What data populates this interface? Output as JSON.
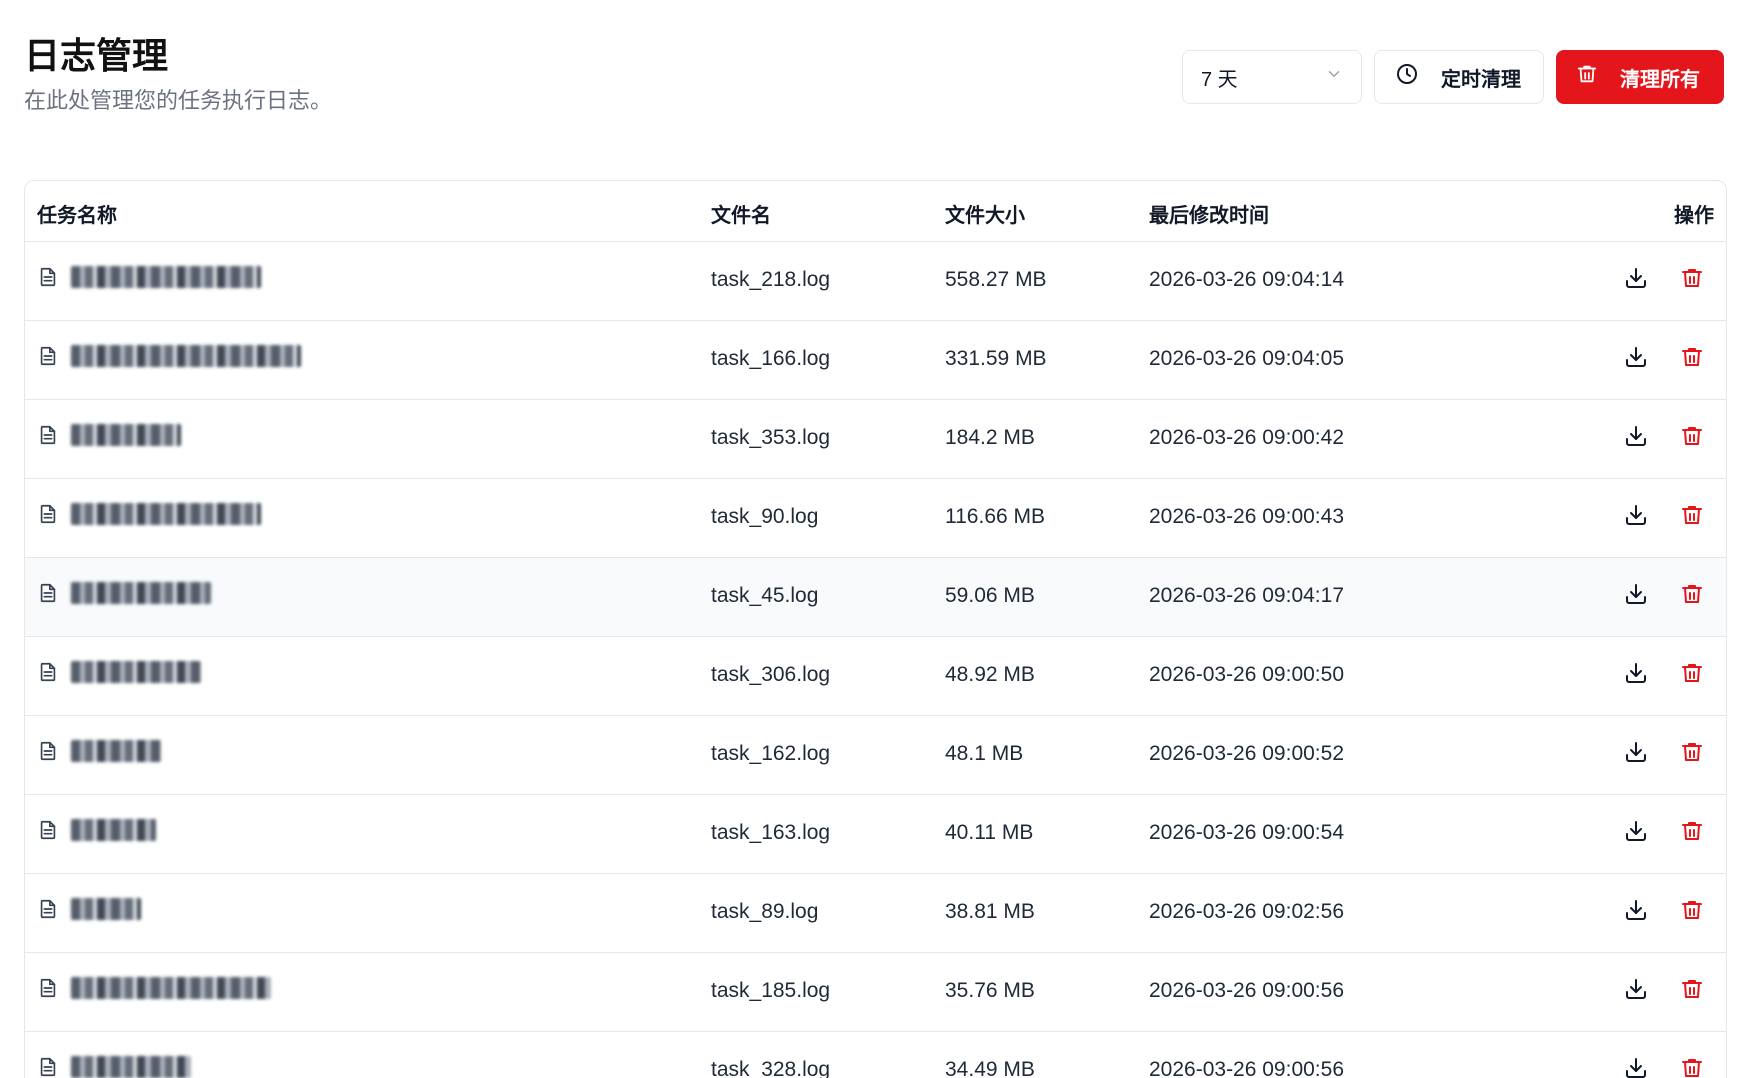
{
  "header": {
    "title": "日志管理",
    "subtitle": "在此处管理您的任务执行日志。"
  },
  "toolbar": {
    "period_select_value": "7 天",
    "schedule_button_label": "定时清理",
    "clear_all_button_label": "清理所有"
  },
  "table": {
    "columns": {
      "task_name": "任务名称",
      "file_name": "文件名",
      "file_size": "文件大小",
      "modified": "最后修改时间",
      "actions": "操作"
    },
    "rows": [
      {
        "file": "task_218.log",
        "size": "558.27 MB",
        "modified": "2026-03-26 09:04:14"
      },
      {
        "file": "task_166.log",
        "size": "331.59 MB",
        "modified": "2026-03-26 09:04:05"
      },
      {
        "file": "task_353.log",
        "size": "184.2 MB",
        "modified": "2026-03-26 09:00:42"
      },
      {
        "file": "task_90.log",
        "size": "116.66 MB",
        "modified": "2026-03-26 09:00:43"
      },
      {
        "file": "task_45.log",
        "size": "59.06 MB",
        "modified": "2026-03-26 09:04:17"
      },
      {
        "file": "task_306.log",
        "size": "48.92 MB",
        "modified": "2026-03-26 09:00:50"
      },
      {
        "file": "task_162.log",
        "size": "48.1 MB",
        "modified": "2026-03-26 09:00:52"
      },
      {
        "file": "task_163.log",
        "size": "40.11 MB",
        "modified": "2026-03-26 09:00:54"
      },
      {
        "file": "task_89.log",
        "size": "38.81 MB",
        "modified": "2026-03-26 09:02:56"
      },
      {
        "file": "task_185.log",
        "size": "35.76 MB",
        "modified": "2026-03-26 09:00:56"
      },
      {
        "file": "task_328.log",
        "size": "34.49 MB",
        "modified": "2026-03-26 09:00:56"
      }
    ]
  },
  "colors": {
    "danger": "#e5161b",
    "row_hover": "#f8fafc",
    "border": "#e5e7eb",
    "muted_text": "#6b7280"
  },
  "icons": {
    "select_chevron": "chevron-down-icon",
    "schedule": "clock-icon",
    "clear_all": "trash-icon",
    "row_file": "file-text-icon",
    "row_download": "download-icon",
    "row_delete": "trash-icon"
  }
}
